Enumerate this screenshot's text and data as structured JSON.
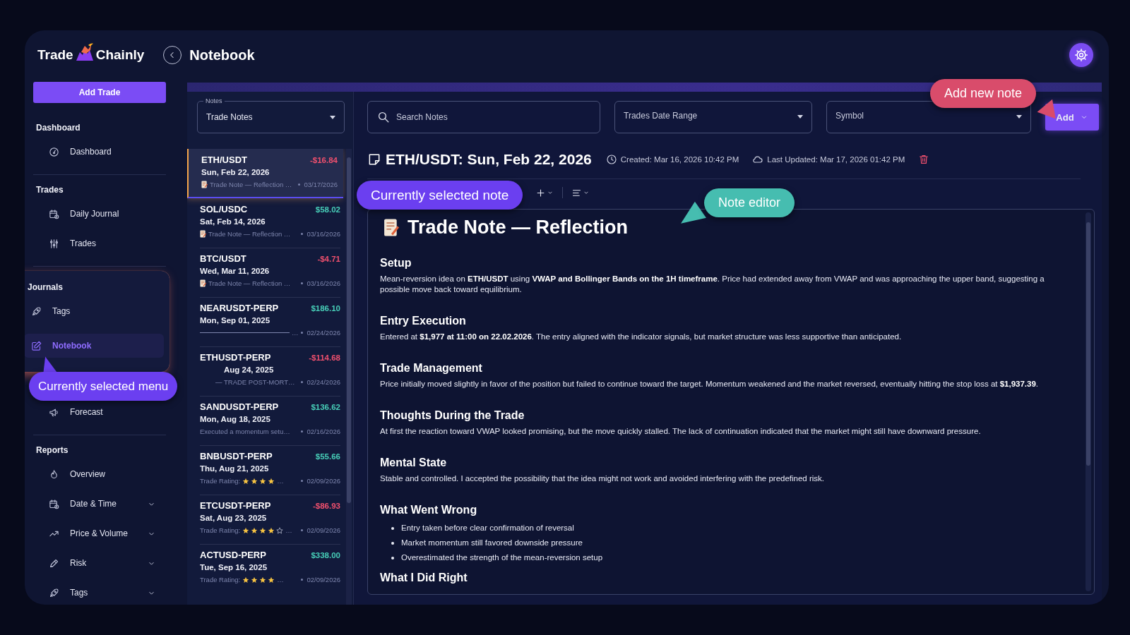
{
  "header": {
    "logo_left": "Trade",
    "logo_right": "Chainly",
    "title": "Notebook"
  },
  "sidebar": {
    "add_button": "Add Trade",
    "sections": [
      {
        "title": "Dashboard",
        "items": [
          {
            "label": "Dashboard",
            "kind": "gauge",
            "selected": false
          }
        ]
      },
      {
        "title": "Trades",
        "items": [
          {
            "label": "Daily Journal",
            "kind": "calendar",
            "selected": false
          },
          {
            "label": "Trades",
            "kind": "sliders",
            "selected": false
          }
        ]
      },
      {
        "title": "Journals",
        "spotlight": true,
        "items": [
          {
            "label": "Tags",
            "kind": "rocket",
            "selected": false
          },
          {
            "label": "Notebook",
            "kind": "edit",
            "selected": true
          },
          {
            "label": "Forecast",
            "kind": "megaphone",
            "selected": false
          }
        ]
      },
      {
        "title": "Reports",
        "items": [
          {
            "label": "Overview",
            "kind": "flame",
            "selected": false
          },
          {
            "label": "Date & Time",
            "kind": "calendar",
            "selected": false,
            "expanded": false
          },
          {
            "label": "Price & Volume",
            "kind": "trend",
            "selected": false,
            "expanded": false
          },
          {
            "label": "Risk",
            "kind": "pen",
            "selected": false,
            "expanded": false
          },
          {
            "label": "Tags",
            "kind": "rocket",
            "selected": false,
            "expanded": false
          }
        ]
      }
    ]
  },
  "notes_panel": {
    "filter": {
      "label": "Notes",
      "value": "Trade Notes"
    },
    "items": [
      {
        "symbol": "ETH/USDT",
        "date": "Sun, Feb 22, 2026",
        "pnl": "-$16.84",
        "color": "#f0506e",
        "selected": true,
        "preview": {
          "kind": "note",
          "text": "Trade Note — Reflection …"
        },
        "updated": "03/17/2026"
      },
      {
        "symbol": "SOL/USDC",
        "date": "Sat, Feb 14, 2026",
        "pnl": "$58.02",
        "color": "#47cdb7",
        "selected": false,
        "preview": {
          "kind": "note",
          "text": "Trade Note — Reflection …"
        },
        "updated": "03/16/2026"
      },
      {
        "symbol": "BTC/USDT",
        "date": "Wed, Mar 11, 2026",
        "pnl": "-$4.71",
        "color": "#f0506e",
        "selected": false,
        "preview": {
          "kind": "note",
          "text": "Trade Note — Reflection …"
        },
        "updated": "03/16/2026"
      },
      {
        "symbol": "NEARUSDT-PERP",
        "date": "Mon, Sep 01, 2025",
        "pnl": "$186.10",
        "color": "#47cdb7",
        "selected": false,
        "preview": {
          "kind": "line",
          "text": "…"
        },
        "updated": "02/24/2026"
      },
      {
        "symbol": "ETHUSDT-PERP",
        "date": "Aug 24, 2025",
        "pnl": "-$114.68",
        "color": "#f0506e",
        "selected": false,
        "obscured": true,
        "preview": {
          "kind": "text",
          "text": "— TRADE POST-MORT…"
        },
        "updated": "02/24/2026"
      },
      {
        "symbol": "SANDUSDT-PERP",
        "date": "Mon, Aug 18, 2025",
        "pnl": "$136.62",
        "color": "#47cdb7",
        "selected": false,
        "preview": {
          "kind": "text",
          "text": "Executed a momentum setu…"
        },
        "updated": "02/16/2026"
      },
      {
        "symbol": "BNBUSDT-PERP",
        "date": "Thu, Aug 21, 2025",
        "pnl": "$55.66",
        "color": "#47cdb7",
        "selected": false,
        "preview": {
          "kind": "rating",
          "label": "Trade Rating:",
          "stars": 4,
          "truncated": true,
          "text": "…"
        },
        "updated": "02/09/2026"
      },
      {
        "symbol": "ETCUSDT-PERP",
        "date": "Sat, Aug 23, 2025",
        "pnl": "-$86.93",
        "color": "#f0506e",
        "selected": false,
        "preview": {
          "kind": "rating",
          "label": "Trade Rating:",
          "stars": 4,
          "truncated": false,
          "text": "…"
        },
        "updated": "02/09/2026"
      },
      {
        "symbol": "ACTUSD-PERP",
        "date": "Tue, Sep 16, 2025",
        "pnl": "$338.00",
        "color": "#47cdb7",
        "selected": false,
        "preview": {
          "kind": "rating",
          "label": "Trade Rating:",
          "stars": 4,
          "truncated": true,
          "text": "…"
        },
        "updated": "02/09/2026"
      }
    ]
  },
  "filters": {
    "search_placeholder": "Search Notes",
    "date_range": "Trades Date Range",
    "symbol": "Symbol",
    "add_button": "Add"
  },
  "note": {
    "title": "ETH/USDT: Sun, Feb 22, 2026",
    "created": "Created: Mar 16, 2026 10:42 PM",
    "updated": "Last Updated: Mar 17, 2026 01:42 PM"
  },
  "editor": {
    "title": "Trade Note — Reflection",
    "blocks": [
      {
        "kind": "heading",
        "text": "Setup"
      },
      {
        "kind": "paragraph",
        "text": "Mean-reversion idea on **ETH/USDT** using **VWAP and Bollinger Bands on the 1H timeframe**. Price had extended away from VWAP and was approaching the upper band, suggesting a possible move back toward equilibrium."
      },
      {
        "kind": "heading",
        "text": "Entry Execution"
      },
      {
        "kind": "paragraph",
        "text": "Entered at **$1,977 at 11:00 on 22.02.2026**. The entry aligned with the indicator signals, but market structure was less supportive than anticipated."
      },
      {
        "kind": "heading",
        "text": "Trade Management"
      },
      {
        "kind": "paragraph",
        "text": "Price initially moved slightly in favor of the position but failed to continue toward the target. Momentum weakened and the market reversed, eventually hitting the stop loss at **$1,937.39**."
      },
      {
        "kind": "heading",
        "text": "Thoughts During the Trade"
      },
      {
        "kind": "paragraph",
        "text": "At first the reaction toward VWAP looked promising, but the move quickly stalled. The lack of continuation indicated that the market might still have downward pressure."
      },
      {
        "kind": "heading",
        "text": "Mental State"
      },
      {
        "kind": "paragraph",
        "text": "Stable and controlled. I accepted the possibility that the idea might not work and avoided interfering with the predefined risk."
      },
      {
        "kind": "heading",
        "text": "What Went Wrong"
      },
      {
        "kind": "list",
        "items": [
          "Entry taken before clear confirmation of reversal",
          "Market momentum still favored downside pressure",
          "Overestimated the strength of the mean-reversion setup"
        ]
      },
      {
        "kind": "heading",
        "text": "What I Did Right"
      }
    ]
  },
  "annotations": [
    {
      "kind": "add",
      "text": "Add new note",
      "color": "#d94c6b"
    },
    {
      "kind": "note",
      "text": "Currently selected note",
      "color": "#6b3ff0"
    },
    {
      "kind": "editor",
      "text": "Note editor",
      "color": "#46bdb0"
    },
    {
      "kind": "menu",
      "text": "Currently selected menu",
      "color": "#6b3ff0"
    }
  ]
}
